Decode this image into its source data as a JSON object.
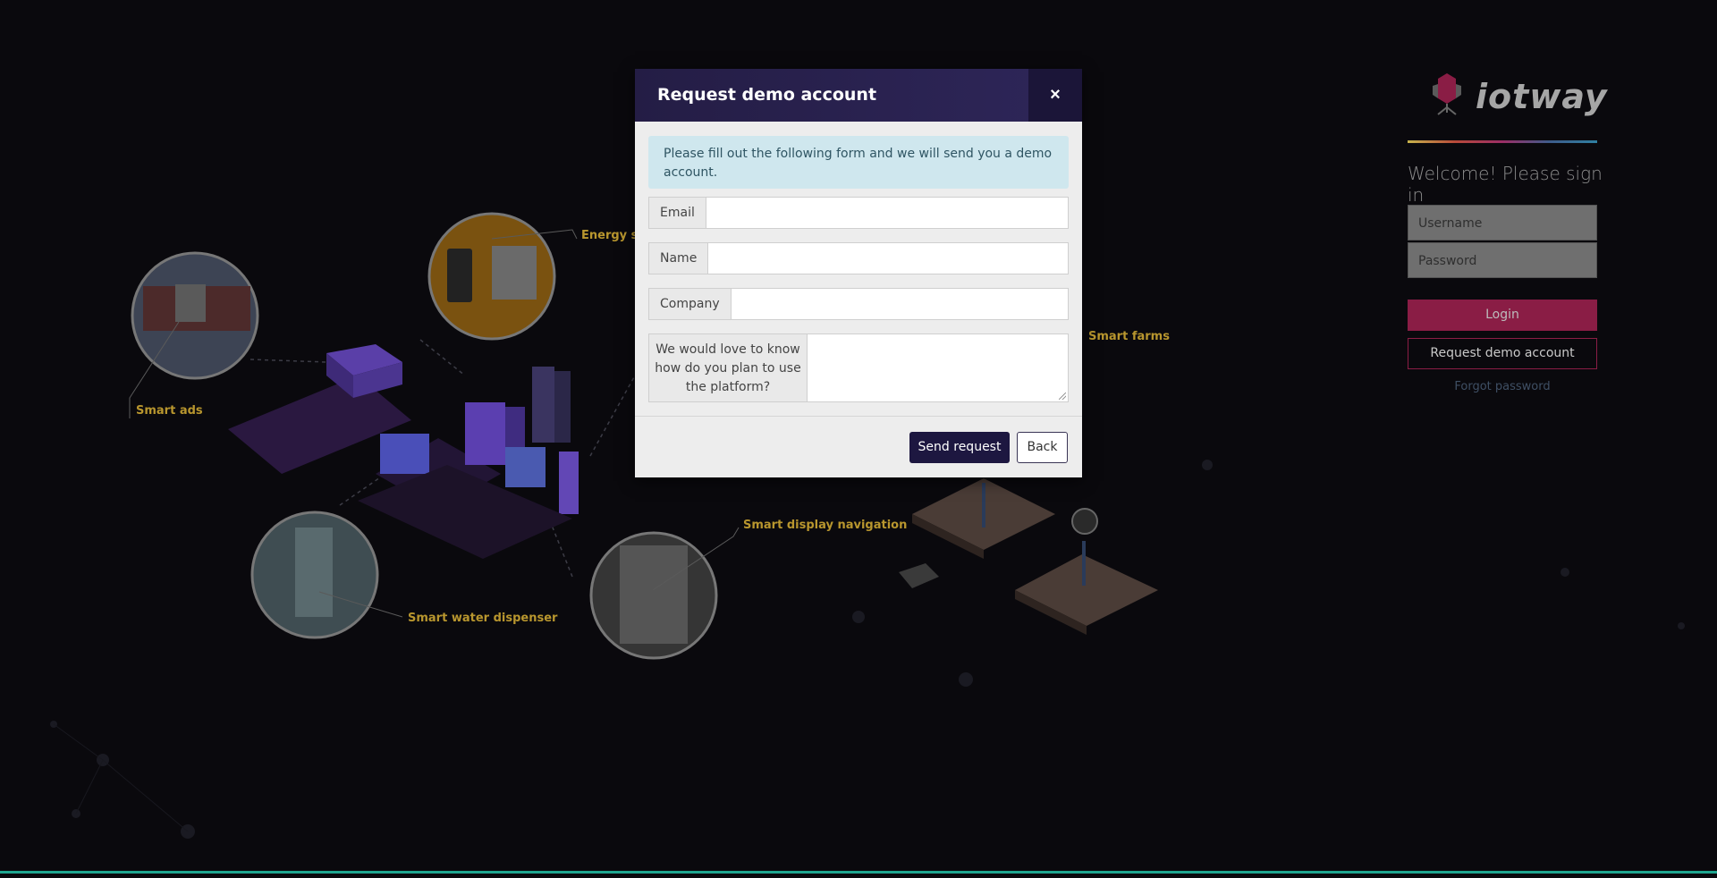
{
  "scene": {
    "labels": {
      "smart_ads": "Smart ads",
      "energy": "Energy sa",
      "smart_farms": "Smart farms",
      "smart_water": "Smart water dispenser",
      "smart_display": "Smart display navigation"
    }
  },
  "signin": {
    "logo_text": "iotway",
    "welcome": "Welcome! Please sign in",
    "username_placeholder": "Username",
    "password_placeholder": "Password",
    "login_label": "Login",
    "request_demo_label": "Request demo account",
    "forgot_label": "Forgot password"
  },
  "modal": {
    "title": "Request demo account",
    "close_icon": "close-icon",
    "alert_text": "Please fill out the following form and we will send you a demo account.",
    "fields": {
      "email_label": "Email",
      "name_label": "Name",
      "company_label": "Company",
      "usage_label": "We would love to know how do you plan to use the platform?"
    },
    "send_label": "Send request",
    "back_label": "Back"
  },
  "colors": {
    "modal_header": "#2e2659",
    "login_button": "#8a1d45",
    "send_button": "#1d1740",
    "label_text": "#b8962e"
  }
}
